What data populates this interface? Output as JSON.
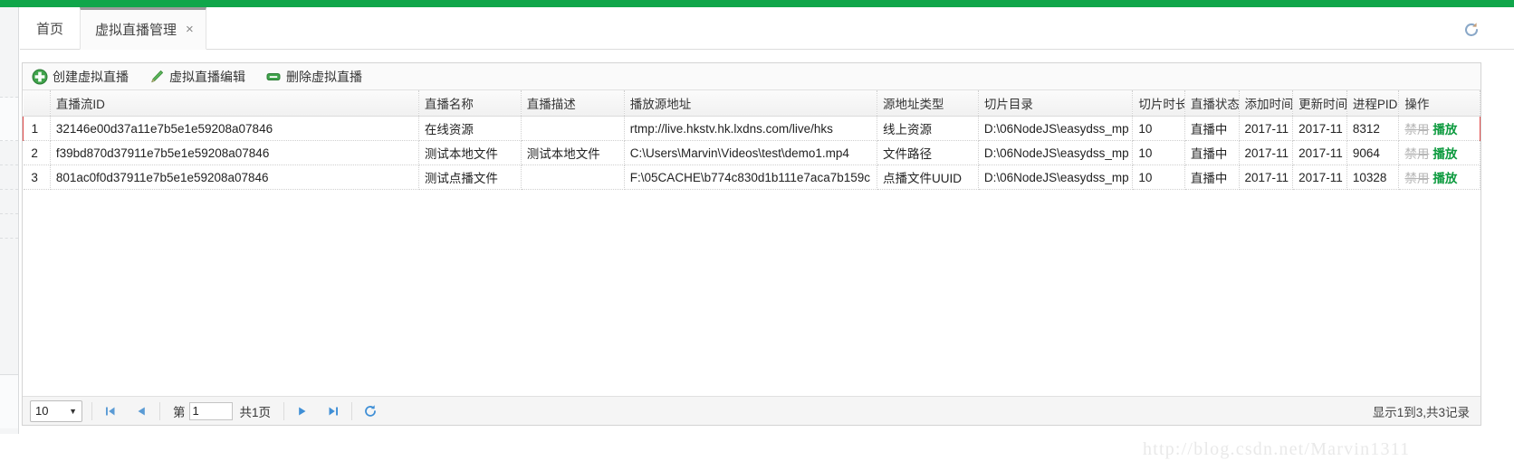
{
  "theme": {
    "brand_green": "#10a64a",
    "link_green": "#0c9a3e",
    "selected_row_border": "#e04a4a"
  },
  "tabs": {
    "home_label": "首页",
    "active_label": "虚拟直播管理",
    "close_label": "×",
    "refresh_icon": "refresh-icon"
  },
  "toolbar": {
    "buttons": [
      {
        "label": "创建虚拟直播",
        "icon": "plus-circle-icon"
      },
      {
        "label": "虚拟直播编辑",
        "icon": "pencil-icon"
      },
      {
        "label": "删除虚拟直播",
        "icon": "minus-box-icon"
      }
    ]
  },
  "table": {
    "columns": [
      "",
      "直播流ID",
      "直播名称",
      "直播描述",
      "播放源地址",
      "源地址类型",
      "切片目录",
      "切片时长",
      "直播状态",
      "添加时间",
      "更新时间",
      "进程PID",
      "操作"
    ],
    "rows": [
      {
        "index": "1",
        "stream_id": "32146e00d37a11e7b5e1e59208a07846",
        "name": "在线资源",
        "description": "",
        "source_url": "rtmp://live.hkstv.hk.lxdns.com/live/hks",
        "source_type": "线上资源",
        "slice_dir": "D:\\06NodeJS\\easydss_mp",
        "slice_duration": "10",
        "status": "直播中",
        "add_time": "2017-11",
        "update_time": "2017-11",
        "pid": "8312",
        "op_disable": "禁用",
        "op_play": "播放",
        "selected": true
      },
      {
        "index": "2",
        "stream_id": "f39bd870d37911e7b5e1e59208a07846",
        "name": "测试本地文件",
        "description": "测试本地文件",
        "source_url": "C:\\Users\\Marvin\\Videos\\test\\demo1.mp4",
        "source_type": "文件路径",
        "slice_dir": "D:\\06NodeJS\\easydss_mp",
        "slice_duration": "10",
        "status": "直播中",
        "add_time": "2017-11",
        "update_time": "2017-11",
        "pid": "9064",
        "op_disable": "禁用",
        "op_play": "播放",
        "selected": false
      },
      {
        "index": "3",
        "stream_id": "801ac0f0d37911e7b5e1e59208a07846",
        "name": "测试点播文件",
        "description": "",
        "source_url": "F:\\05CACHE\\b774c830d1b111e7aca7b159c",
        "source_type": "点播文件UUID",
        "slice_dir": "D:\\06NodeJS\\easydss_mp",
        "slice_duration": "10",
        "status": "直播中",
        "add_time": "2017-11",
        "update_time": "2017-11",
        "pid": "10328",
        "op_disable": "禁用",
        "op_play": "播放",
        "selected": false
      }
    ]
  },
  "pager": {
    "page_size": "10",
    "page_size_caret": "▼",
    "first_icon": "first-page-icon",
    "prev_icon": "prev-page-icon",
    "page_prefix": "第",
    "page_value": "1",
    "page_total": "共1页",
    "next_icon": "next-page-icon",
    "last_icon": "last-page-icon",
    "refresh_icon": "pager-refresh-icon",
    "summary": "显示1到3,共3记录"
  },
  "watermark": {
    "text": "http://blog.csdn.net/Marvin1311"
  }
}
